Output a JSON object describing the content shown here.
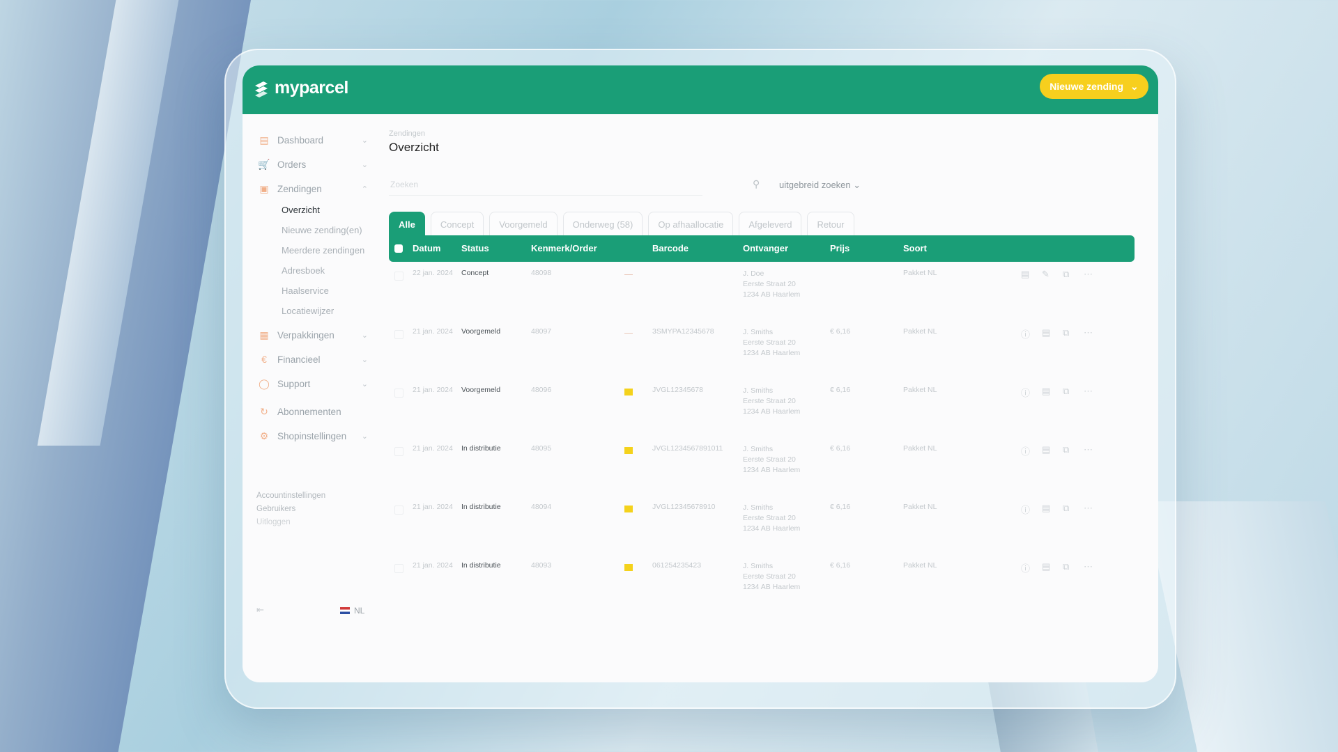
{
  "brand": {
    "name": "myparcel"
  },
  "header": {
    "new_shipment_label": "Nieuwe zending"
  },
  "sidebar": {
    "items": [
      {
        "label": "Dashboard",
        "icon": "dashboard-icon"
      },
      {
        "label": "Orders",
        "icon": "cart-icon"
      },
      {
        "label": "Zendingen",
        "icon": "box-icon"
      },
      {
        "label": "Verpakkingen",
        "icon": "package-icon"
      },
      {
        "label": "Financieel",
        "icon": "euro-icon"
      },
      {
        "label": "Support",
        "icon": "support-icon"
      },
      {
        "label": "Abonnementen",
        "icon": "subscription-icon"
      },
      {
        "label": "Shopinstellingen",
        "icon": "settings-icon"
      }
    ],
    "sub_items": [
      "Overzicht",
      "Nieuwe zending(en)",
      "Meerdere zendingen",
      "Adresboek",
      "Haalservice",
      "Locatiewijzer"
    ],
    "footer_links": [
      "Accountinstellingen",
      "Gebruikers",
      "Uitloggen"
    ],
    "language": "NL"
  },
  "main": {
    "breadcrumb": "Zendingen",
    "title": "Overzicht",
    "search": {
      "placeholder": "Zoeken",
      "advanced_label": "uitgebreid zoeken"
    },
    "tabs": [
      "Alle",
      "Concept",
      "Voorgemeld",
      "Onderweg (58)",
      "Op afhaallocatie",
      "Afgeleverd",
      "Retour"
    ],
    "columns": [
      "Datum",
      "Status",
      "Kenmerk/Order",
      "Barcode",
      "Ontvanger",
      "Prijs",
      "Soort"
    ],
    "rows": [
      {
        "date": "22 jan. 2024",
        "status": "Concept",
        "order": "48098",
        "barcode": "",
        "name": "J. Doe",
        "street": "Eerste Straat 20",
        "city": "1234 AB Haarlem",
        "price": "",
        "type": "Pakket NL"
      },
      {
        "date": "21 jan. 2024",
        "status": "Voorgemeld",
        "order": "48097",
        "barcode": "3SMYPA12345678",
        "name": "J. Smiths",
        "street": "Eerste Straat 20",
        "city": "1234 AB Haarlem",
        "price": "€ 6,16",
        "type": "Pakket NL"
      },
      {
        "date": "21 jan. 2024",
        "status": "Voorgemeld",
        "order": "48096",
        "barcode": "JVGL12345678",
        "name": "J. Smiths",
        "street": "Eerste Straat 20",
        "city": "1234 AB Haarlem",
        "price": "€ 6,16",
        "type": "Pakket NL"
      },
      {
        "date": "21 jan. 2024",
        "status": "In distributie",
        "order": "48095",
        "barcode": "JVGL1234567891011",
        "name": "J. Smiths",
        "street": "Eerste Straat 20",
        "city": "1234 AB Haarlem",
        "price": "€ 6,16",
        "type": "Pakket NL"
      },
      {
        "date": "21 jan. 2024",
        "status": "In distributie",
        "order": "48094",
        "barcode": "JVGL12345678910",
        "name": "J. Smiths",
        "street": "Eerste Straat 20",
        "city": "1234 AB Haarlem",
        "price": "€ 6,16",
        "type": "Pakket NL"
      },
      {
        "date": "21 jan. 2024",
        "status": "In distributie",
        "order": "48093",
        "barcode": "061254235423",
        "name": "J. Smiths",
        "street": "Eerste Straat 20",
        "city": "1234 AB Haarlem",
        "price": "€ 6,16",
        "type": "Pakket NL"
      }
    ]
  },
  "colors": {
    "brand_green": "#1a9e77",
    "accent_yellow": "#f7cf1e"
  }
}
